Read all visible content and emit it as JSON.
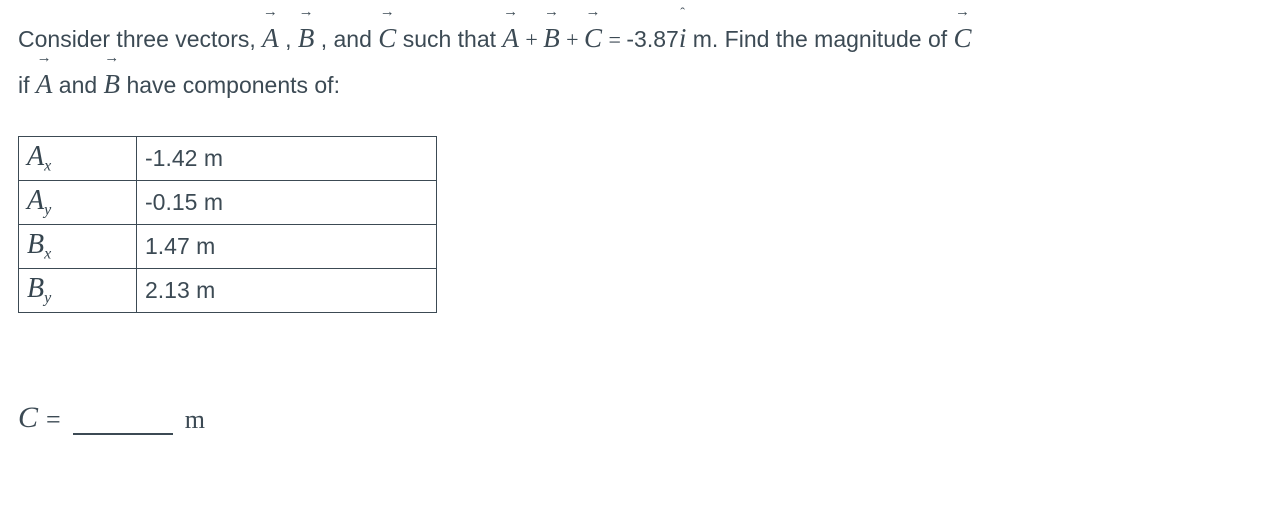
{
  "problem": {
    "intro1": "Consider three vectors, ",
    "vA": "A",
    "sep1": " , ",
    "vB": "B",
    "sep2": " , and ",
    "vC": "C",
    "intro2": " such that ",
    "eq_rhs_value": "-3.87",
    "ihat": "i",
    "unit1": " m. Find the magnitude of ",
    "vC2": "C",
    "line2a": "if ",
    "vA2": "A",
    "line2b": " and ",
    "vB2": "B",
    "line2c": " have components of:"
  },
  "table": {
    "rows": [
      {
        "label_base": "A",
        "label_sub": "x",
        "value": "-1.42 m"
      },
      {
        "label_base": "A",
        "label_sub": "y",
        "value": "-0.15 m"
      },
      {
        "label_base": "B",
        "label_sub": "x",
        "value": "1.47 m"
      },
      {
        "label_base": "B",
        "label_sub": "y",
        "value": "2.13 m"
      }
    ]
  },
  "answer": {
    "C": "C",
    "equals": "=",
    "unit": "m"
  }
}
